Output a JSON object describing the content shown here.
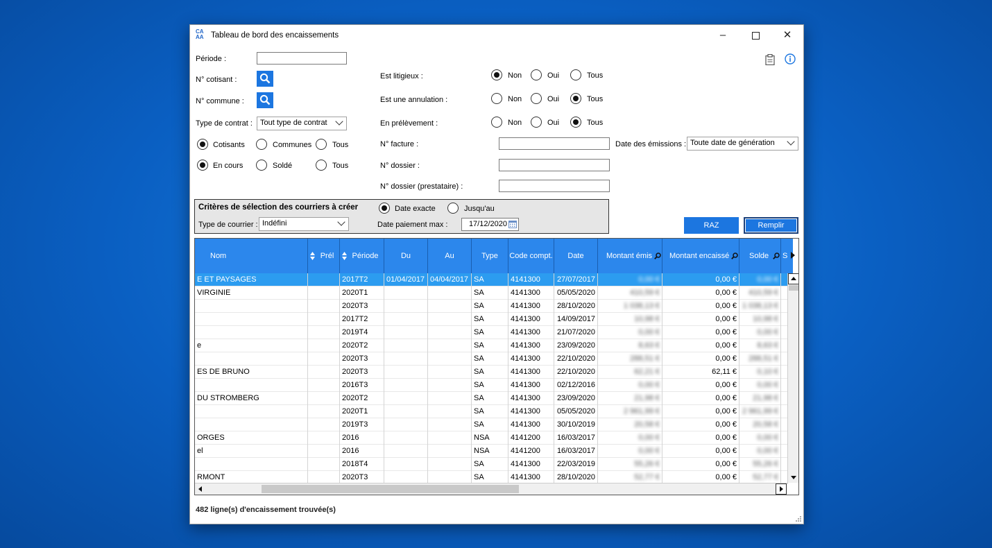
{
  "window": {
    "title": "Tableau de bord des encaissements",
    "logo_text": "CA AA"
  },
  "filters": {
    "periode_label": "Période :",
    "cotisant_label": "N° cotisant :",
    "commune_label": "N° commune :",
    "type_contrat_label": "Type de contrat :",
    "type_contrat_value": "Tout type de contrat",
    "cotisants_group": {
      "cotisants": "Cotisants",
      "communes": "Communes",
      "tous": "Tous",
      "selected": "Cotisants"
    },
    "etat_group": {
      "en_cours": "En cours",
      "solde": "Soldé",
      "tous": "Tous",
      "selected": "En cours"
    },
    "litigieux": {
      "label": "Est litigieux :",
      "non": "Non",
      "oui": "Oui",
      "tous": "Tous",
      "selected": "Non"
    },
    "annulation": {
      "label": "Est une annulation :",
      "non": "Non",
      "oui": "Oui",
      "tous": "Tous",
      "selected": "Tous"
    },
    "prelevement": {
      "label": "En prélèvement :",
      "non": "Non",
      "oui": "Oui",
      "tous": "Tous",
      "selected": "Tous"
    },
    "facture_label": "N° facture :",
    "dossier_label": "N° dossier :",
    "dossier_prest_label": "N° dossier (prestataire) :",
    "emissions_label": "Date des émissions :",
    "emissions_value": "Toute date de génération"
  },
  "criteria": {
    "title": "Critères de sélection des courriers à créer",
    "date_exacte": "Date exacte",
    "jusqu_au": "Jusqu'au",
    "selected": "Date exacte",
    "type_courrier_label": "Type de courrier :",
    "type_courrier_value": "Indéfini",
    "date_paiement_label": "Date paiement max :",
    "date_paiement_value": "17/12/2020"
  },
  "buttons": {
    "raz": "RAZ",
    "remplir": "Remplir"
  },
  "table": {
    "columns": [
      "Nom",
      "Prél",
      "Période",
      "Du",
      "Au",
      "Type",
      "Code compt.",
      "Date",
      "Montant émis",
      "Montant encaissé",
      "Solde",
      "S"
    ],
    "rows": [
      {
        "nom": "E ET PAYSAGES",
        "prel": "",
        "periode": "2017T2",
        "du": "01/04/2017",
        "au": "04/04/2017",
        "type": "SA",
        "code": "4141300",
        "date": "27/07/2017",
        "emis": "0,00 €",
        "encaisse": "0,00 €",
        "solde": "0,00 €"
      },
      {
        "nom": "VIRGINIE",
        "prel": "",
        "periode": "2020T1",
        "du": "",
        "au": "",
        "type": "SA",
        "code": "4141300",
        "date": "05/05/2020",
        "emis": "410,59 €",
        "encaisse": "0,00 €",
        "solde": "410,59 €"
      },
      {
        "nom": "",
        "prel": "",
        "periode": "2020T3",
        "du": "",
        "au": "",
        "type": "SA",
        "code": "4141300",
        "date": "28/10/2020",
        "emis": "1 038,13 €",
        "encaisse": "0,00 €",
        "solde": "1 038,13 €"
      },
      {
        "nom": "",
        "prel": "",
        "periode": "2017T2",
        "du": "",
        "au": "",
        "type": "SA",
        "code": "4141300",
        "date": "14/09/2017",
        "emis": "10,98 €",
        "encaisse": "0,00 €",
        "solde": "10,98 €"
      },
      {
        "nom": "",
        "prel": "",
        "periode": "2019T4",
        "du": "",
        "au": "",
        "type": "SA",
        "code": "4141300",
        "date": "21/07/2020",
        "emis": "0,00 €",
        "encaisse": "0,00 €",
        "solde": "0,00 €"
      },
      {
        "nom": "e",
        "prel": "",
        "periode": "2020T2",
        "du": "",
        "au": "",
        "type": "SA",
        "code": "4141300",
        "date": "23/09/2020",
        "emis": "8,63 €",
        "encaisse": "0,00 €",
        "solde": "8,63 €"
      },
      {
        "nom": "",
        "prel": "",
        "periode": "2020T3",
        "du": "",
        "au": "",
        "type": "SA",
        "code": "4141300",
        "date": "22/10/2020",
        "emis": "288,51 €",
        "encaisse": "0,00 €",
        "solde": "288,51 €"
      },
      {
        "nom": "ES DE BRUNO",
        "prel": "",
        "periode": "2020T3",
        "du": "",
        "au": "",
        "type": "SA",
        "code": "4141300",
        "date": "22/10/2020",
        "emis": "62,21 €",
        "encaisse": "62,11 €",
        "solde": "0,10 €"
      },
      {
        "nom": "",
        "prel": "",
        "periode": "2016T3",
        "du": "",
        "au": "",
        "type": "SA",
        "code": "4141300",
        "date": "02/12/2016",
        "emis": "0,00 €",
        "encaisse": "0,00 €",
        "solde": "0,00 €"
      },
      {
        "nom": "DU STROMBERG",
        "prel": "",
        "periode": "2020T2",
        "du": "",
        "au": "",
        "type": "SA",
        "code": "4141300",
        "date": "23/09/2020",
        "emis": "21,98 €",
        "encaisse": "0,00 €",
        "solde": "21,98 €"
      },
      {
        "nom": "",
        "prel": "",
        "periode": "2020T1",
        "du": "",
        "au": "",
        "type": "SA",
        "code": "4141300",
        "date": "05/05/2020",
        "emis": "2 961,99 €",
        "encaisse": "0,00 €",
        "solde": "2 961,99 €"
      },
      {
        "nom": "",
        "prel": "",
        "periode": "2019T3",
        "du": "",
        "au": "",
        "type": "SA",
        "code": "4141300",
        "date": "30/10/2019",
        "emis": "20,58 €",
        "encaisse": "0,00 €",
        "solde": "20,58 €"
      },
      {
        "nom": "ORGES",
        "prel": "",
        "periode": "2016",
        "du": "",
        "au": "",
        "type": "NSA",
        "code": "4141200",
        "date": "16/03/2017",
        "emis": "0,00 €",
        "encaisse": "0,00 €",
        "solde": "0,00 €"
      },
      {
        "nom": "el",
        "prel": "",
        "periode": "2016",
        "du": "",
        "au": "",
        "type": "NSA",
        "code": "4141200",
        "date": "16/03/2017",
        "emis": "0,00 €",
        "encaisse": "0,00 €",
        "solde": "0,00 €"
      },
      {
        "nom": "",
        "prel": "",
        "periode": "2018T4",
        "du": "",
        "au": "",
        "type": "SA",
        "code": "4141300",
        "date": "22/03/2019",
        "emis": "55,26 €",
        "encaisse": "0,00 €",
        "solde": "55,26 €"
      },
      {
        "nom": "RMONT",
        "prel": "",
        "periode": "2020T3",
        "du": "",
        "au": "",
        "type": "SA",
        "code": "4141300",
        "date": "28/10/2020",
        "emis": "52,77 €",
        "encaisse": "0,00 €",
        "solde": "52,77 €"
      }
    ]
  },
  "status": {
    "text": "482 ligne(s) d'encaissement trouvée(s)"
  },
  "colors": {
    "accent": "#1c76e0",
    "header": "#2c87ec",
    "selected_row": "#2c9cf0"
  }
}
